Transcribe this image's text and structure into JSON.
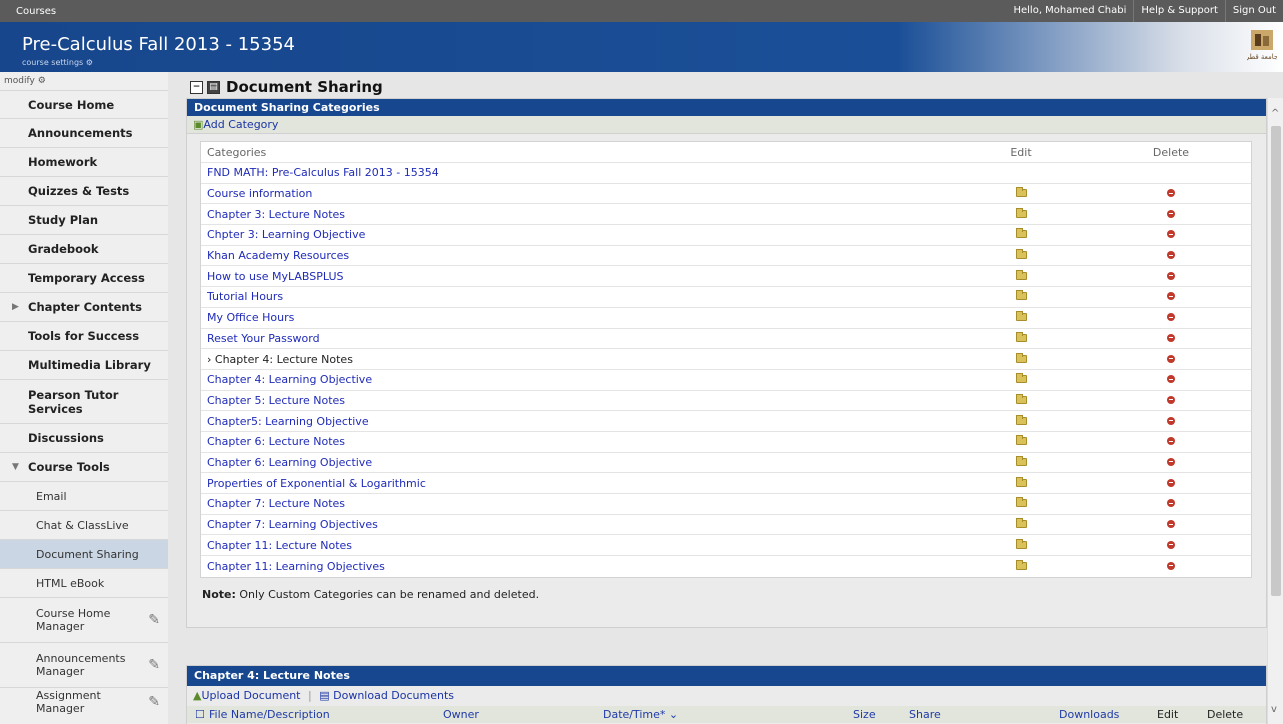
{
  "topbar": {
    "courses": "Courses",
    "greeting": "Hello, Mohamed Chabi",
    "help": "Help & Support",
    "signout": "Sign Out"
  },
  "banner": {
    "title": "Pre-Calculus Fall 2013 - 15354",
    "settings": "course settings",
    "logo_text": "جامعة قطر"
  },
  "sidebar": {
    "modify": "modify",
    "items": [
      {
        "label": "Course Home"
      },
      {
        "label": "Announcements"
      },
      {
        "label": "Homework"
      },
      {
        "label": "Quizzes & Tests"
      },
      {
        "label": "Study Plan"
      },
      {
        "label": "Gradebook"
      },
      {
        "label": "Temporary Access"
      },
      {
        "label": "Chapter Contents"
      },
      {
        "label": "Tools for Success"
      },
      {
        "label": "Multimedia Library"
      },
      {
        "label": "Pearson Tutor Services"
      },
      {
        "label": "Discussions"
      },
      {
        "label": "Course Tools"
      },
      {
        "label": "Email"
      },
      {
        "label": "Chat & ClassLive"
      },
      {
        "label": "Document Sharing"
      },
      {
        "label": "HTML eBook"
      },
      {
        "label": "Course Home Manager"
      },
      {
        "label": "Announcements Manager"
      },
      {
        "label": "Assignment Manager"
      }
    ]
  },
  "main": {
    "title": "Document Sharing",
    "categories_panel": {
      "header": "Document Sharing Categories",
      "add_category": "Add Category",
      "col_categories": "Categories",
      "col_edit": "Edit",
      "col_delete": "Delete",
      "rows": [
        "FND MATH: Pre-Calculus Fall 2013 - 15354",
        "Course information",
        "Chapter 3: Lecture Notes",
        "Chpter 3: Learning Objective",
        "Khan Academy Resources",
        "How to use MyLABSPLUS",
        "Tutorial Hours",
        "My Office Hours",
        "Reset Your Password",
        "Chapter 4: Lecture Notes",
        "Chapter 4: Learning Objective",
        "Chapter 5: Lecture Notes",
        "Chapter5: Learning Objective",
        "Chapter 6: Lecture Notes",
        "Chapter 6: Learning Objective",
        "Properties of Exponential & Logarithmic",
        "Chapter 7: Lecture Notes",
        "Chapter 7: Learning Objectives",
        "Chapter 11: Lecture Notes",
        "Chapter 11: Learning Objectives"
      ],
      "note_label": "Note:",
      "note_text": "Only Custom Categories can be renamed and deleted."
    },
    "docs_panel": {
      "header": "Chapter 4: Lecture Notes",
      "upload": "Upload Document",
      "download": "Download Documents",
      "columns": {
        "file": "File Name/Description",
        "owner": "Owner",
        "date": "Date/Time*",
        "size": "Size",
        "share": "Share",
        "downloads": "Downloads",
        "edit": "Edit",
        "delete": "Delete"
      }
    }
  }
}
